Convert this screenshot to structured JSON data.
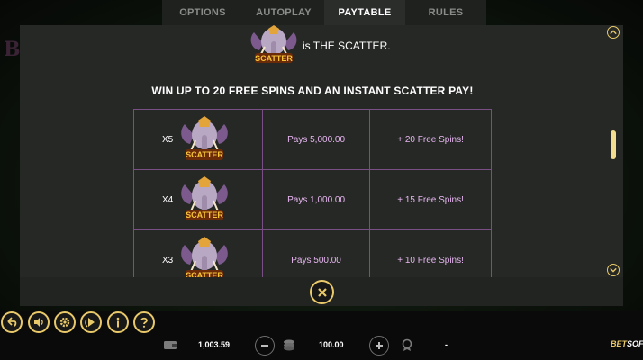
{
  "tabs": [
    {
      "label": "OPTIONS",
      "active": false
    },
    {
      "label": "AUTOPLAY",
      "active": false
    },
    {
      "label": "PAYTABLE",
      "active": true
    },
    {
      "label": "RULES",
      "active": false
    }
  ],
  "background": {
    "deco_letter": "B"
  },
  "scatter": {
    "symbol_label": "SCATTER",
    "description": "is THE SCATTER."
  },
  "headline": "WIN UP TO 20 FREE SPINS AND AN INSTANT SCATTER PAY!",
  "paytable": [
    {
      "multiplier": "X5",
      "pays": "Pays 5,000.00",
      "bonus": "+ 20 Free Spins!"
    },
    {
      "multiplier": "X4",
      "pays": "Pays 1,000.00",
      "bonus": "+ 15 Free Spins!"
    },
    {
      "multiplier": "X3",
      "pays": "Pays 500.00",
      "bonus": "+ 10 Free Spins!"
    }
  ],
  "footer": {
    "balance": "1,003.59",
    "bet": "100.00",
    "win": "-",
    "brand_a": "BET",
    "brand_b": "SOFT"
  },
  "colors": {
    "accent": "#e9c96a",
    "table_border": "#7a4f86",
    "table_text": "#e7b6f0"
  }
}
